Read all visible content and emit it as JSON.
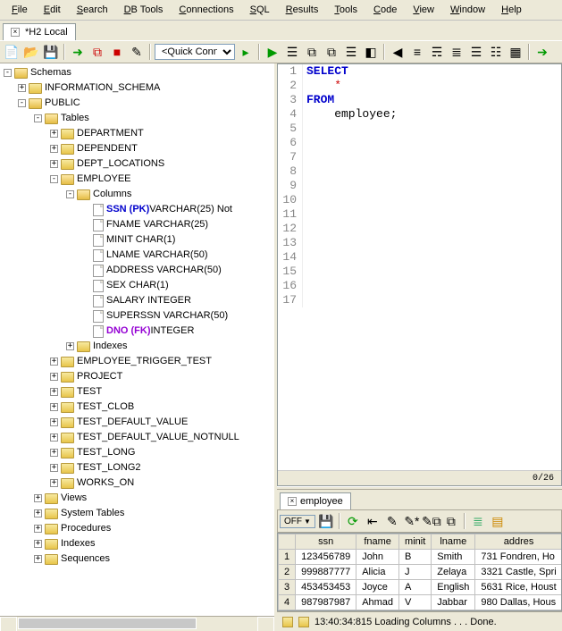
{
  "menu": {
    "items": [
      "File",
      "Edit",
      "Search",
      "DB Tools",
      "Connections",
      "SQL",
      "Results",
      "Tools",
      "Code",
      "View",
      "Window",
      "Help"
    ]
  },
  "tab": {
    "title": "*H2 Local"
  },
  "quick_connect": "<Quick Connect>",
  "tree": {
    "root": "Schemas",
    "info": "INFORMATION_SCHEMA",
    "public": "PUBLIC",
    "tables": "Tables",
    "tables_list": [
      "DEPARTMENT",
      "DEPENDENT",
      "DEPT_LOCATIONS"
    ],
    "employee": {
      "name": "EMPLOYEE",
      "columns_label": "Columns",
      "columns": [
        {
          "name": "SSN (PK)",
          "type": "VARCHAR(25) Not",
          "pk": true
        },
        {
          "name": "FNAME",
          "type": "VARCHAR(25)"
        },
        {
          "name": "MINIT",
          "type": "CHAR(1)"
        },
        {
          "name": "LNAME",
          "type": "VARCHAR(50)"
        },
        {
          "name": "ADDRESS",
          "type": "VARCHAR(50)"
        },
        {
          "name": "SEX",
          "type": "CHAR(1)"
        },
        {
          "name": "SALARY",
          "type": "INTEGER"
        },
        {
          "name": "SUPERSSN",
          "type": "VARCHAR(50)"
        },
        {
          "name": "DNO (FK)",
          "type": "INTEGER",
          "fk": true
        }
      ],
      "indexes_label": "Indexes"
    },
    "tables_after": [
      "EMPLOYEE_TRIGGER_TEST",
      "PROJECT",
      "TEST",
      "TEST_CLOB",
      "TEST_DEFAULT_VALUE",
      "TEST_DEFAULT_VALUE_NOTNULL",
      "TEST_LONG",
      "TEST_LONG2",
      "WORKS_ON"
    ],
    "views": "Views",
    "systables": "System Tables",
    "procedures": "Procedures",
    "indexes": "Indexes",
    "sequences": "Sequences"
  },
  "sql": {
    "lines": [
      "SELECT",
      "    *",
      "FROM",
      "    employee;",
      "",
      "",
      "",
      "",
      "",
      "",
      "",
      "",
      "",
      "",
      "",
      "",
      ""
    ],
    "counter": "0/26"
  },
  "results_tab": "employee",
  "off": "OFF",
  "grid": {
    "headers": [
      "ssn",
      "fname",
      "minit",
      "lname",
      "addres"
    ],
    "rows": [
      [
        "123456789",
        "John",
        "B",
        "Smith",
        "731 Fondren, Ho"
      ],
      [
        "999887777",
        "Alicia",
        "J",
        "Zelaya",
        "3321 Castle, Spri"
      ],
      [
        "453453453",
        "Joyce",
        "A",
        "English",
        "5631 Rice, Houst"
      ],
      [
        "987987987",
        "Ahmad",
        "V",
        "Jabbar",
        "980 Dallas, Hous"
      ]
    ]
  },
  "status": "13:40:34:815 Loading Columns . . . Done."
}
